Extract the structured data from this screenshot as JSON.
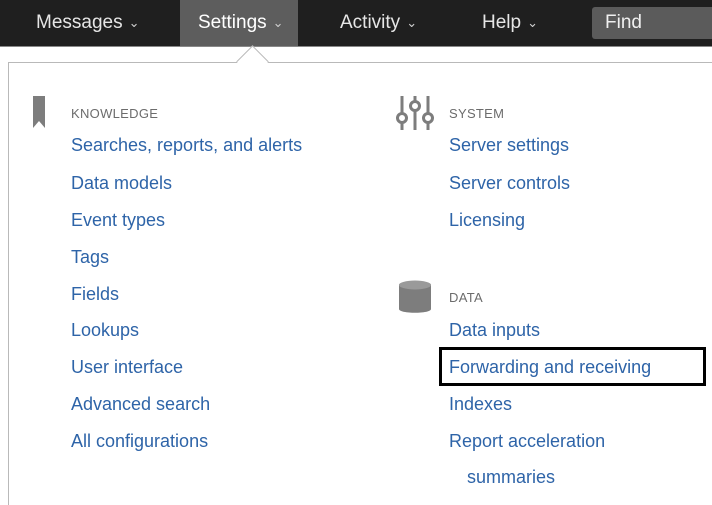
{
  "nav": {
    "items": [
      {
        "label": "Messages",
        "active": false
      },
      {
        "label": "Settings",
        "active": true
      },
      {
        "label": "Activity",
        "active": false
      },
      {
        "label": "Help",
        "active": false
      }
    ],
    "find_label": "Find"
  },
  "knowledge": {
    "heading": "KNOWLEDGE",
    "icon": "bookmark-icon",
    "links": [
      "Searches, reports, and alerts",
      "Data models",
      "Event types",
      "Tags",
      "Fields",
      "Lookups",
      "User interface",
      "Advanced search",
      "All configurations"
    ]
  },
  "system": {
    "heading": "SYSTEM",
    "icon": "sliders-icon",
    "links": [
      "Server settings",
      "Server controls",
      "Licensing"
    ]
  },
  "data": {
    "heading": "DATA",
    "icon": "database-icon",
    "links": [
      "Data inputs",
      "Forwarding and receiving",
      "Indexes",
      "Report acceleration",
      "summaries"
    ]
  },
  "colors": {
    "topbar": "#1f1f1f",
    "active_tab": "#5d5d5d",
    "link": "#2e64a8",
    "heading": "#6c6c6c"
  }
}
